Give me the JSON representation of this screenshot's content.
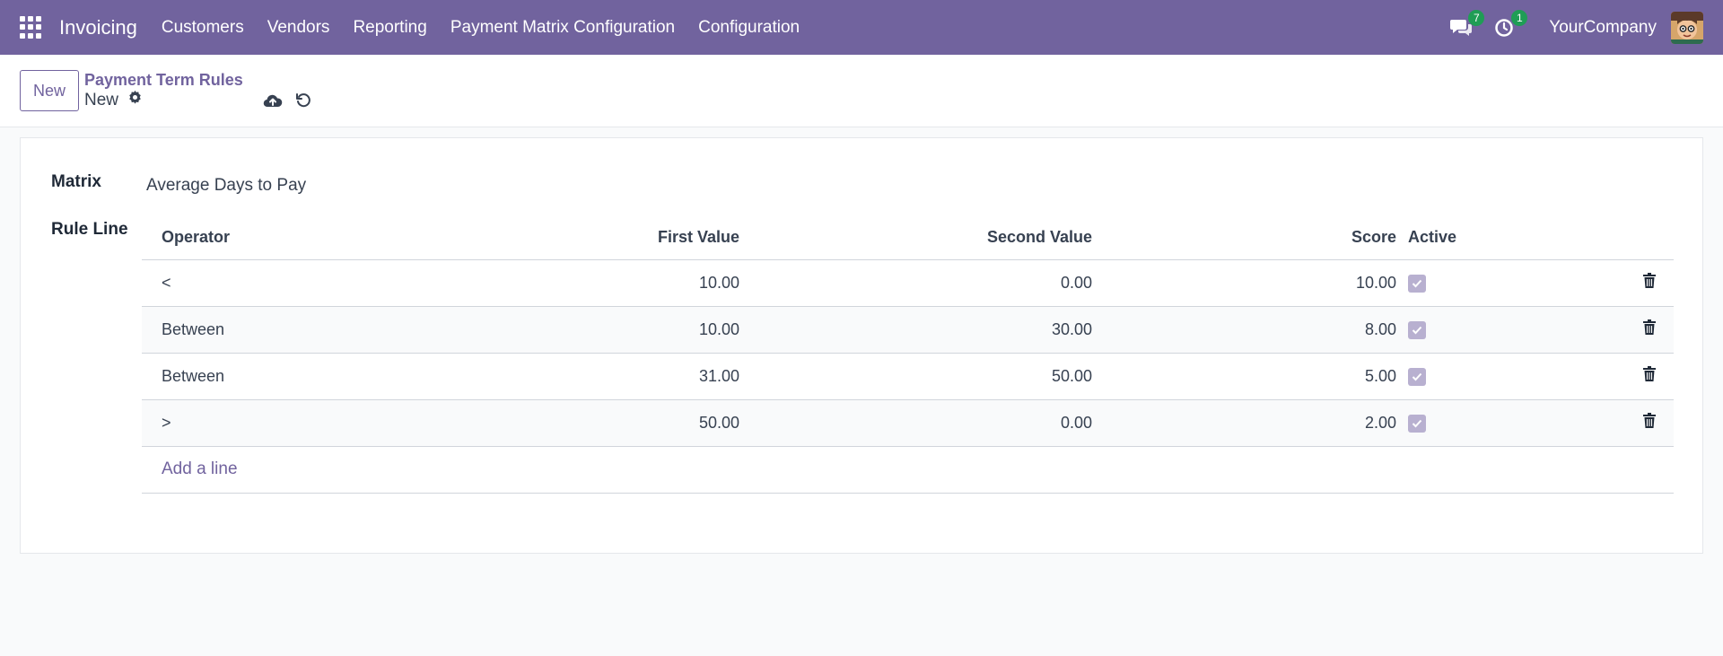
{
  "navbar": {
    "app_name": "Invoicing",
    "menu": [
      "Customers",
      "Vendors",
      "Reporting",
      "Payment Matrix Configuration",
      "Configuration"
    ],
    "messages_count": "7",
    "activities_count": "1",
    "company": "YourCompany",
    "icons": [
      "apps-grid-icon",
      "chat-icon",
      "clock-icon"
    ],
    "colors": {
      "brand": "#71639e",
      "badge": "#1f9d55"
    }
  },
  "control": {
    "new_button": "New",
    "breadcrumb_parent": "Payment Term Rules",
    "breadcrumb_current": "New",
    "icons": [
      "gear-icon",
      "cloud-upload-icon",
      "discard-icon"
    ]
  },
  "form": {
    "matrix_label": "Matrix",
    "matrix_value": "Average Days to Pay",
    "rule_line_label": "Rule Line",
    "columns": {
      "operator": "Operator",
      "first_value": "First Value",
      "second_value": "Second Value",
      "score": "Score",
      "active": "Active"
    },
    "rows": [
      {
        "operator": "<",
        "first_value": "10.00",
        "second_value": "0.00",
        "score": "10.00",
        "active": true
      },
      {
        "operator": "Between",
        "first_value": "10.00",
        "second_value": "30.00",
        "score": "8.00",
        "active": true
      },
      {
        "operator": "Between",
        "first_value": "31.00",
        "second_value": "50.00",
        "score": "5.00",
        "active": true
      },
      {
        "operator": ">",
        "first_value": "50.00",
        "second_value": "0.00",
        "score": "2.00",
        "active": true
      }
    ],
    "add_line": "Add a line"
  }
}
